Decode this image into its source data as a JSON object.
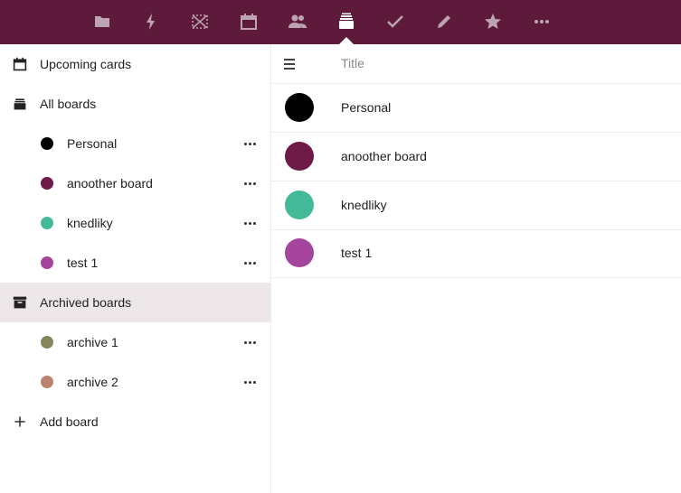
{
  "topbar": {
    "icons": [
      "folder-icon",
      "activity-icon",
      "gallery-icon",
      "calendar-icon",
      "contacts-icon",
      "deck-icon",
      "tasks-icon",
      "notes-icon",
      "favorites-icon",
      "more-icon"
    ],
    "active": "deck-icon",
    "background": "#5e1a3b"
  },
  "sidebar": {
    "upcoming": {
      "label": "Upcoming cards",
      "icon": "calendar-icon"
    },
    "all_boards": {
      "label": "All boards",
      "icon": "boards-icon"
    },
    "boards": [
      {
        "label": "Personal",
        "color": "#000000"
      },
      {
        "label": "anoother board",
        "color": "#6e1a47"
      },
      {
        "label": "knedliky",
        "color": "#44b997"
      },
      {
        "label": "test 1",
        "color": "#a4449a"
      }
    ],
    "archived": {
      "label": "Archived boards",
      "icon": "archive-icon"
    },
    "archived_boards": [
      {
        "label": "archive 1",
        "color": "#86865c"
      },
      {
        "label": "archive 2",
        "color": "#bb826f"
      }
    ],
    "add_board": {
      "label": "Add board",
      "icon": "plus-icon"
    }
  },
  "main": {
    "column_title": "Title",
    "rows": [
      {
        "label": "Personal",
        "color": "#000000"
      },
      {
        "label": "anoother board",
        "color": "#6e1a47"
      },
      {
        "label": "knedliky",
        "color": "#44b997"
      },
      {
        "label": "test 1",
        "color": "#a4449a"
      }
    ]
  }
}
